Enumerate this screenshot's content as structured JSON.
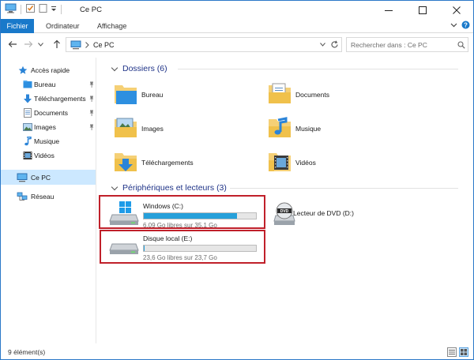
{
  "window": {
    "title": "Ce PC"
  },
  "ribbon": {
    "tabs": [
      {
        "label": "Fichier",
        "active": true
      },
      {
        "label": "Ordinateur",
        "active": false
      },
      {
        "label": "Affichage",
        "active": false
      }
    ]
  },
  "address": {
    "path": "Ce PC",
    "search_placeholder": "Rechercher dans : Ce PC"
  },
  "sidebar": {
    "items": [
      {
        "label": "Accès rapide",
        "icon": "star-icon"
      },
      {
        "label": "Bureau",
        "icon": "desktop-folder-icon",
        "pinned": true
      },
      {
        "label": "Téléchargements",
        "icon": "download-arrow-icon",
        "pinned": true
      },
      {
        "label": "Documents",
        "icon": "documents-icon",
        "pinned": true
      },
      {
        "label": "Images",
        "icon": "pictures-icon",
        "pinned": true
      },
      {
        "label": "Musique",
        "icon": "music-note-icon"
      },
      {
        "label": "Vidéos",
        "icon": "videos-icon"
      },
      {
        "label": "Ce PC",
        "icon": "computer-icon",
        "selected": true
      },
      {
        "label": "Réseau",
        "icon": "network-icon"
      }
    ]
  },
  "folders": {
    "header": "Dossiers (6)",
    "items": [
      {
        "label": "Bureau",
        "icon": "desktop-folder-icon"
      },
      {
        "label": "Documents",
        "icon": "documents-folder-icon"
      },
      {
        "label": "Images",
        "icon": "pictures-folder-icon"
      },
      {
        "label": "Musique",
        "icon": "music-folder-icon"
      },
      {
        "label": "Téléchargements",
        "icon": "downloads-folder-icon"
      },
      {
        "label": "Vidéos",
        "icon": "videos-folder-icon"
      }
    ]
  },
  "devices": {
    "header": "Périphériques et lecteurs (3)",
    "drives": [
      {
        "name": "Windows (C:)",
        "free_text": "6,09 Go libres sur 35,1 Go",
        "used_fraction": 0.83,
        "icon": "windows-drive-icon",
        "highlighted": true
      },
      {
        "name": "Lecteur de DVD (D:)",
        "icon": "dvd-drive-icon"
      },
      {
        "name": "Disque local (E:)",
        "free_text": "23,6 Go libres sur 23,7 Go",
        "used_fraction": 0.004,
        "icon": "hard-drive-icon",
        "highlighted": true
      }
    ]
  },
  "status": {
    "count": "9 élément(s)"
  },
  "colors": {
    "accent": "#1979ca",
    "selection": "#cce8ff",
    "progress": "#26a0da",
    "highlight_box": "#c0202a",
    "group_header": "#1e3287"
  }
}
